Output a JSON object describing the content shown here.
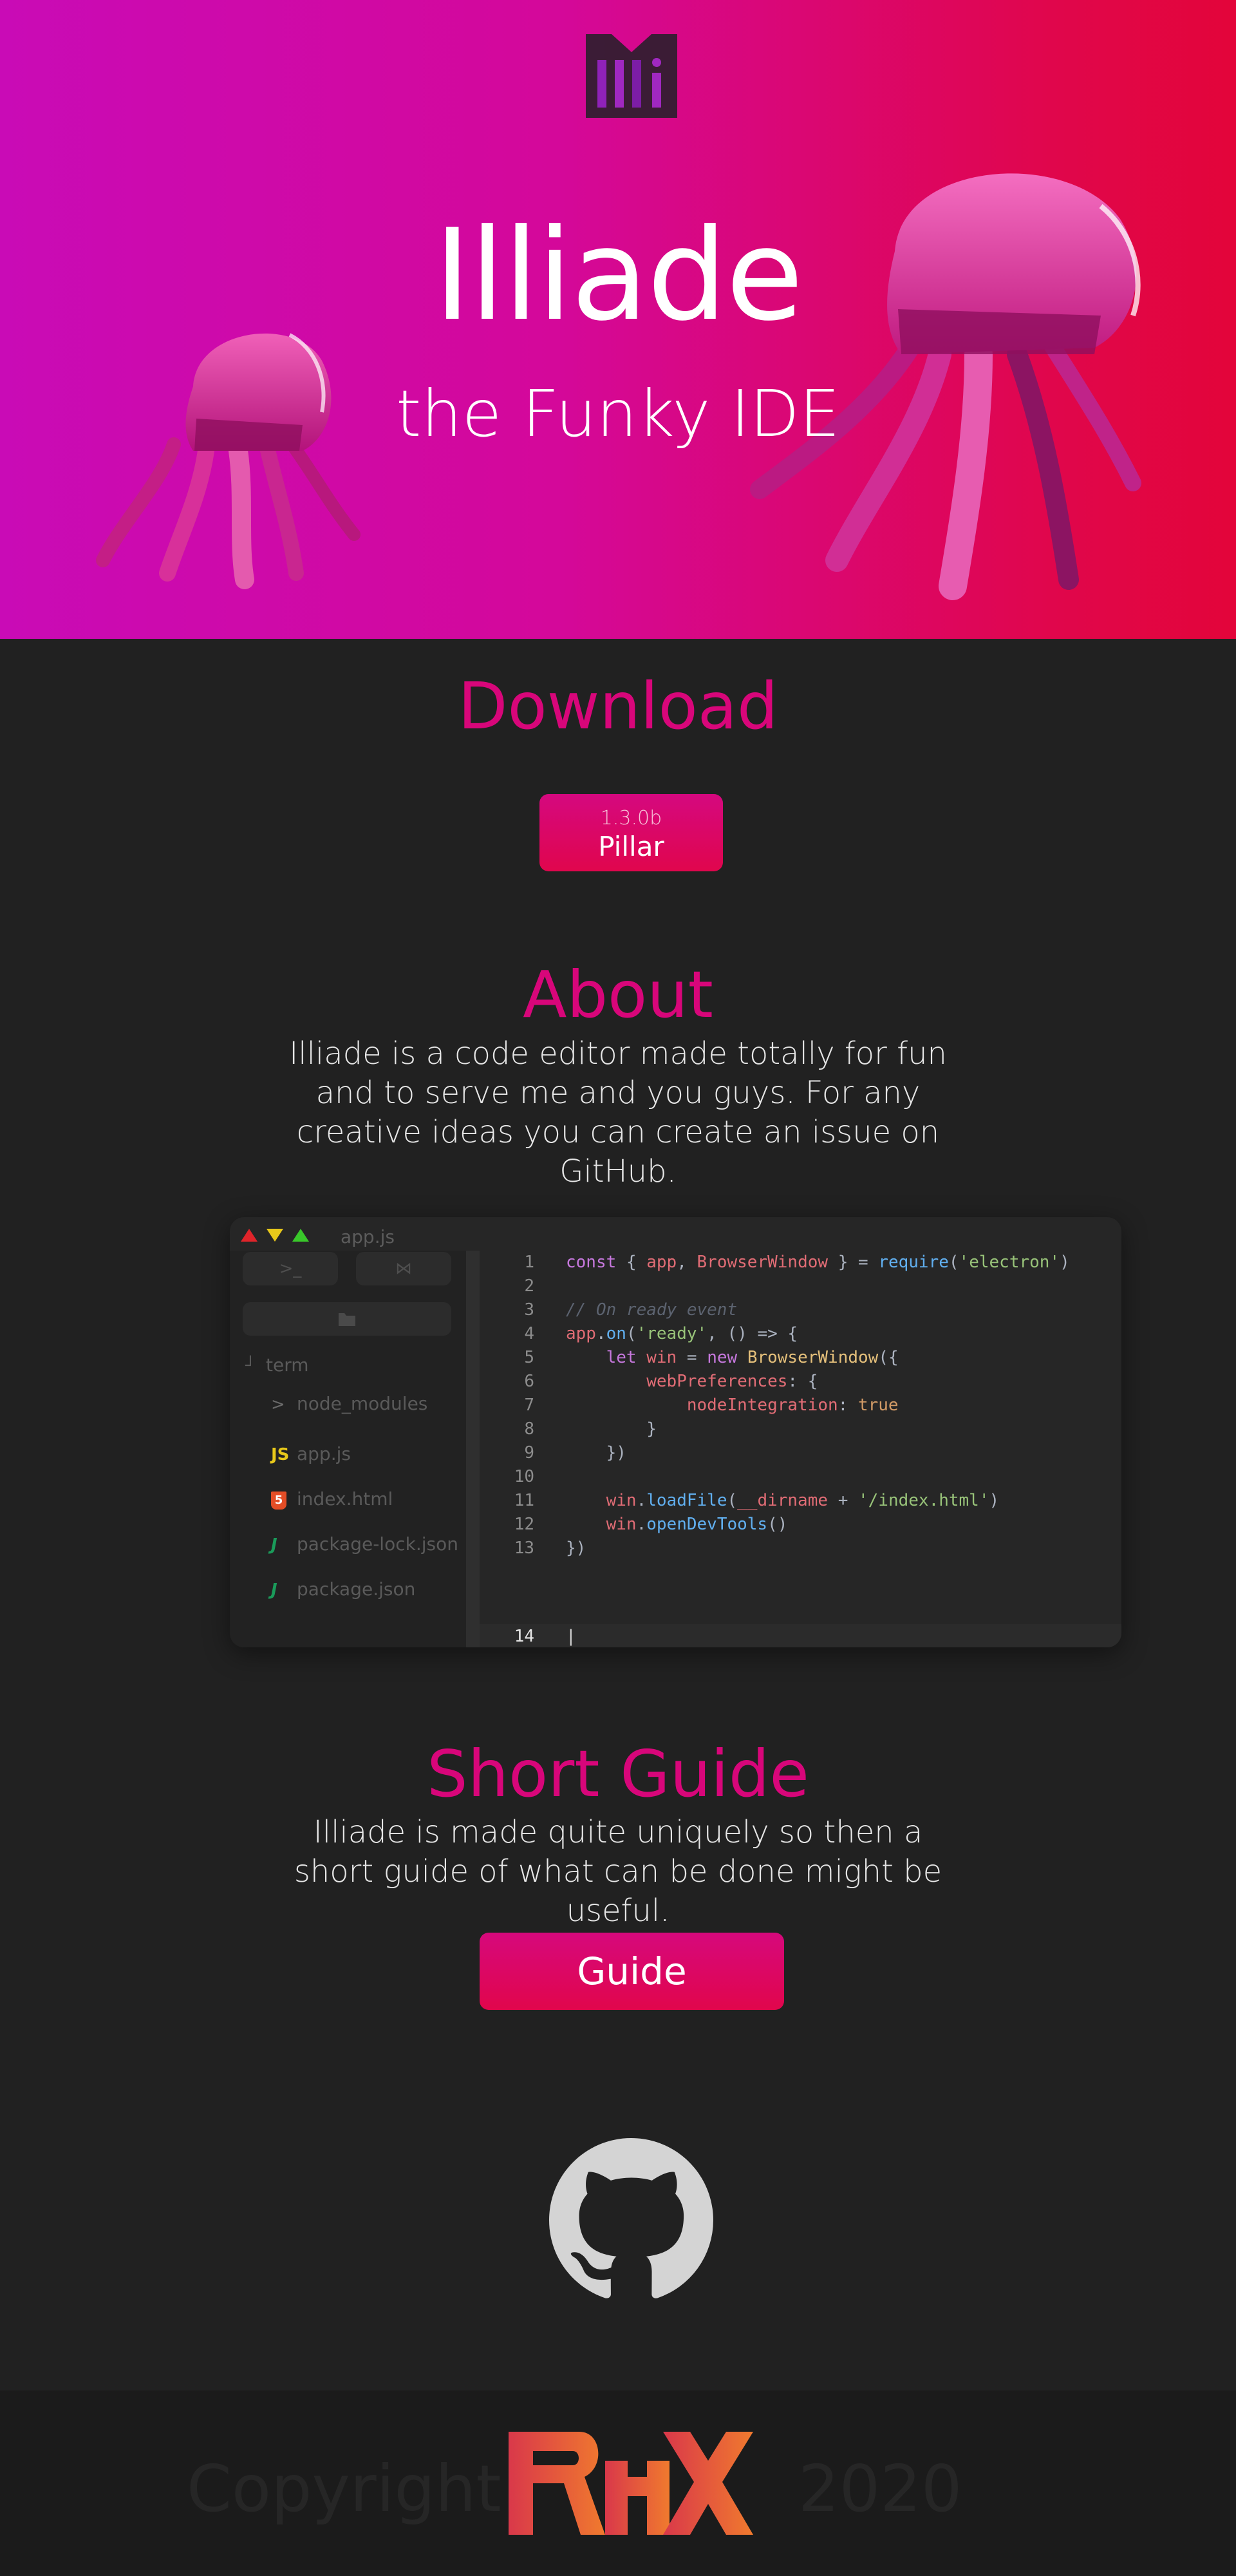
{
  "hero": {
    "title": "Illiade",
    "subtitle": "the Funky IDE",
    "gradient_colors": [
      "#c90bb6",
      "#e3053a"
    ],
    "logo_icon": "illiade-logo-icon",
    "decorations": [
      "jellyfish-left",
      "jellyfish-right"
    ]
  },
  "download": {
    "title": "Download",
    "version": "1.3.0b",
    "label": "Pillar"
  },
  "about": {
    "title": "About",
    "text": "Illiade is a code editor made totally for fun and to serve me and you guys. For any creative ideas you can create an issue on GitHub."
  },
  "editor": {
    "window_controls": [
      "close-icon",
      "minimize-icon",
      "maximize-icon"
    ],
    "open_file": "app.js",
    "sidebar_buttons": [
      ">_",
      "⋈",
      "folder-icon"
    ],
    "tree": {
      "root": "term",
      "items": [
        {
          "name": "node_modules",
          "icon": "chevron-right-icon",
          "icon_text": ">"
        },
        {
          "name": "app.js",
          "icon": "js-icon",
          "icon_text": "JS"
        },
        {
          "name": "index.html",
          "icon": "html5-icon",
          "icon_text": "5"
        },
        {
          "name": "package-lock.json",
          "icon": "npm-icon",
          "icon_text": "J"
        },
        {
          "name": "package.json",
          "icon": "npm-icon",
          "icon_text": "J"
        }
      ]
    },
    "line_numbers": [
      "1",
      "2",
      "3",
      "4",
      "5",
      "6",
      "7",
      "8",
      "9",
      "10",
      "11",
      "12",
      "13",
      "14"
    ],
    "code_lines": [
      "const { app, BrowserWindow } = require('electron')",
      "",
      "// On ready event",
      "app.on('ready', () => {",
      "    let win = new BrowserWindow({",
      "        webPreferences: {",
      "            nodeIntegration: true",
      "        }",
      "    })",
      "",
      "    win.loadFile(__dirname + '/index.html')",
      "    win.openDevTools()",
      "})",
      ""
    ],
    "active_line": "14"
  },
  "guide": {
    "title": "Short Guide",
    "text": "Illiade is made quite uniquely so then a short guide of what can be done might be useful.",
    "button": "Guide"
  },
  "github": {
    "icon": "github-icon"
  },
  "footer": {
    "copyright": "Copyright",
    "year": "2020",
    "logo": "rhx-logo",
    "logo_colors": [
      "#d9384a",
      "#f07a2e"
    ]
  }
}
